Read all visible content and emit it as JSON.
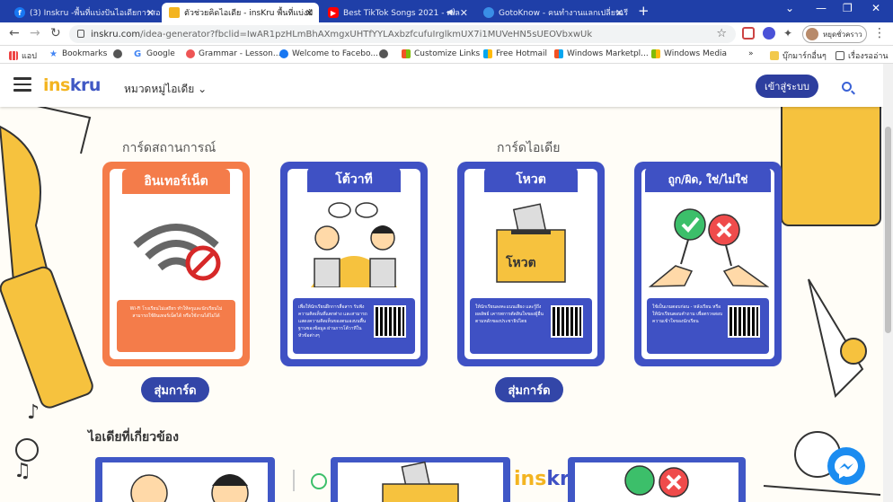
{
  "browser": {
    "tabs": [
      {
        "title": "(3) Inskru -พื้นที่แบ่งปันไอเดียการสอน",
        "close": "✕"
      },
      {
        "title": "ตัวช่วยคิดไอเดีย - insKru พื้นที่แบ่งปั",
        "close": "✕"
      },
      {
        "title": "Best TikTok Songs 2021 - เพล",
        "close": "✕"
      },
      {
        "title": "GotoKnow - คนทำงานแลกเปลี่ยนเรี",
        "close": "✕"
      }
    ],
    "new_tab": "+",
    "url_host": "inskru.com",
    "url_path": "/idea-generator?fbclid=IwAR1pzHLmBhAXmgxUHTfYYLAxbzfcufuIrglkmUX7i1MUVeHN5sUEOVbxwUk",
    "profile_name": "หยุดชั่วคราว",
    "bookmarks": [
      "แอป",
      "Bookmarks",
      "Google",
      "Grammar - Lesson...",
      "Welcome to Facebo...",
      "Customize Links",
      "Free Hotmail",
      "Windows Marketpl...",
      "Windows Media",
      "บุ๊กมาร์กอื่นๆ",
      "เรื่องรออ่าน"
    ],
    "more_bookmarks": "»",
    "colors": {
      "tabbar": "#1f3fa8"
    }
  },
  "header": {
    "logo_a": "ins",
    "logo_b": "kru",
    "category_menu": "หมวดหมู่ไอเดีย",
    "login": "เข้าสู่ระบบ"
  },
  "section": {
    "situation_title": "การ์ดสถานการณ์",
    "idea_title": "การ์ดไอเดีย",
    "random_label": "สุ่มการ์ด",
    "related_title": "ไอเดียที่เกี่ยวข้อง"
  },
  "cards": [
    {
      "title": "อินเทอร์เน็ต",
      "desc": "Wi-Fi โรงเรียนไม่เสถียร ทำให้ครูและนักเรียนไม่สามารถใช้อินเทอร์เน็ตได้ หรือใช้งานได้ไม่ได้",
      "color": "#f47c4a"
    },
    {
      "title": "โต้วาที",
      "desc": "เพื่อให้นักเรียนฝึกการสื่อสาร รับฟังความคิดเห็นที่แตกต่าง และสามารถแสดงความคิดเห็นของตนเองบนพื้นฐานของข้อมูล ผ่านการโต้วาทีในหัวข้อต่างๆ",
      "color": "#3f51c4"
    },
    {
      "title": "โหวต",
      "desc": "ให้นักเรียนลงคะแนนเสียง และรู้ถึงผลลัพธ์ เคารพการตัดสินใจของผู้อื่น ตามหลักของประชาธิปไตย",
      "color": "#3f51c4",
      "box_label": "โหวต"
    },
    {
      "title": "ถูก/ผิด, ใช่/ไม่ใช่",
      "desc": "ใช้เป็นเกมตอบก่อน - หลังเรียน หรือ ให้นักเรียนตอบคำถาม เพื่อตรวจสอบความเข้าใจของนักเรียน",
      "color": "#3f51c4"
    }
  ],
  "icons": [
    "back-icon",
    "forward-icon",
    "reload-icon",
    "lock-icon",
    "star-icon",
    "hamburger-icon",
    "chevron-down-icon",
    "search-icon",
    "messenger-icon"
  ]
}
